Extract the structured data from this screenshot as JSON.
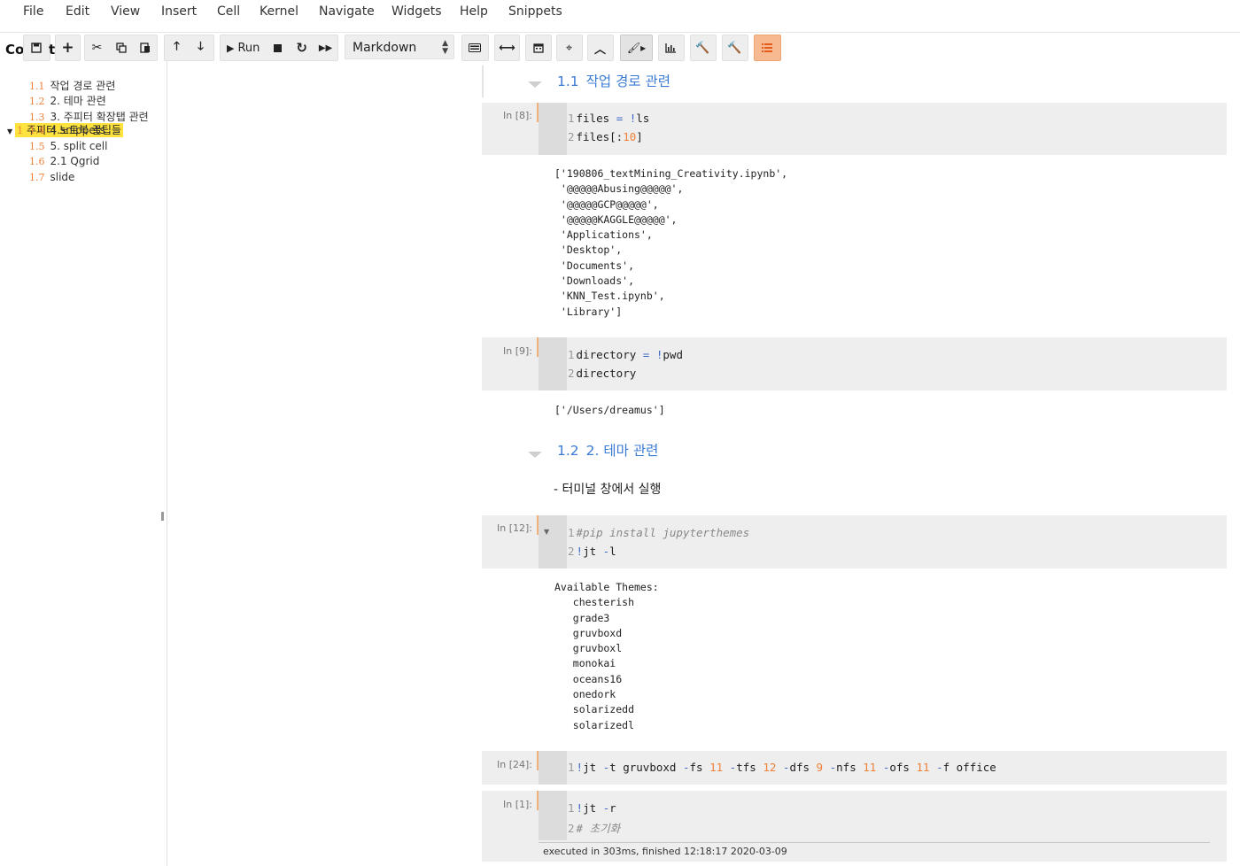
{
  "menu": [
    "File",
    "Edit",
    "View",
    "Insert",
    "Cell",
    "Kernel",
    "Navigate",
    "Widgets",
    "Help",
    "Snippets"
  ],
  "toolbar": {
    "run_label": "Run",
    "cell_type": "Markdown",
    "icons": [
      "save-icon",
      "plus-icon",
      "cut-icon",
      "copy-icon",
      "paste-icon",
      "arrow-up-icon",
      "arrow-down-icon",
      "run-icon",
      "stop-icon",
      "restart-icon",
      "fast-forward-icon",
      "keyboard-icon",
      "horizontal-arrows-icon",
      "calendar-icon",
      "crosshair-icon",
      "chevron-up-icon",
      "brush-icon",
      "bar-chart-icon",
      "hammer-icon",
      "hammer-icon",
      "list-icon"
    ],
    "accent": "#f7b98f"
  },
  "toc": {
    "header_left": "Cor",
    "header_right": "t",
    "top_num": "1",
    "top_label": "주피터 노트북 꿀팁들",
    "items": [
      {
        "num": "1.1",
        "label": "작업 경로 관련"
      },
      {
        "num": "1.2",
        "label": "2. 테마 관련"
      },
      {
        "num": "1.3",
        "label": "3. 주피터 확장탭 관련"
      },
      {
        "num": "1.4",
        "label": "4.snippets"
      },
      {
        "num": "1.5",
        "label": "5. split cell"
      },
      {
        "num": "1.6",
        "label": "2.1 Qgrid"
      },
      {
        "num": "1.7",
        "label": "slide"
      }
    ]
  },
  "notebook": {
    "heading1": {
      "num": "1.1",
      "text": "작업 경로 관련"
    },
    "cell1": {
      "prompt": "In [8]:",
      "lines": [
        {
          "n": "1",
          "parts": [
            {
              "t": "files ",
              "c": ""
            },
            {
              "t": "=",
              "c": "kw"
            },
            {
              "t": " ",
              "c": ""
            },
            {
              "t": "!",
              "c": "kw"
            },
            {
              "t": "ls",
              "c": ""
            }
          ]
        },
        {
          "n": "2",
          "parts": [
            {
              "t": "files[:",
              "c": ""
            },
            {
              "t": "10",
              "c": "num-lit"
            },
            {
              "t": "]",
              "c": ""
            }
          ]
        }
      ],
      "output": "['190806_textMining_Creativity.ipynb',\n '@@@@@Abusing@@@@@',\n '@@@@@GCP@@@@@',\n '@@@@@KAGGLE@@@@@',\n 'Applications',\n 'Desktop',\n 'Documents',\n 'Downloads',\n 'KNN_Test.ipynb',\n 'Library']"
    },
    "cell2": {
      "prompt": "In [9]:",
      "lines": [
        {
          "n": "1",
          "parts": [
            {
              "t": "directory ",
              "c": ""
            },
            {
              "t": "=",
              "c": "kw"
            },
            {
              "t": " ",
              "c": ""
            },
            {
              "t": "!",
              "c": "kw"
            },
            {
              "t": "pwd",
              "c": ""
            }
          ]
        },
        {
          "n": "2",
          "parts": [
            {
              "t": "directory",
              "c": ""
            }
          ]
        }
      ],
      "output": "['/Users/dreamus']"
    },
    "heading2": {
      "num": "1.2",
      "text": "2. 테마 관련"
    },
    "md_text": "- 터미널 창에서 실행",
    "cell3": {
      "prompt": "In [12]:",
      "lines": [
        {
          "n": "1",
          "parts": [
            {
              "t": "#pip install jupyterthemes",
              "c": "cm"
            }
          ]
        },
        {
          "n": "2",
          "parts": [
            {
              "t": "!",
              "c": "kw"
            },
            {
              "t": "jt ",
              "c": ""
            },
            {
              "t": "-",
              "c": "kw"
            },
            {
              "t": "l",
              "c": ""
            }
          ]
        }
      ],
      "output": "Available Themes: \n   chesterish\n   grade3\n   gruvboxd\n   gruvboxl\n   monokai\n   oceans16\n   onedork\n   solarizedd\n   solarizedl"
    },
    "cell4": {
      "prompt": "In [24]:",
      "lines": [
        {
          "n": "1",
          "parts": [
            {
              "t": "!",
              "c": "kw"
            },
            {
              "t": "jt ",
              "c": ""
            },
            {
              "t": "-",
              "c": "kw"
            },
            {
              "t": "t gruvboxd ",
              "c": ""
            },
            {
              "t": "-",
              "c": "kw"
            },
            {
              "t": "fs ",
              "c": ""
            },
            {
              "t": "11",
              "c": "num-lit"
            },
            {
              "t": " ",
              "c": ""
            },
            {
              "t": "-",
              "c": "kw"
            },
            {
              "t": "tfs ",
              "c": ""
            },
            {
              "t": "12",
              "c": "num-lit"
            },
            {
              "t": " ",
              "c": ""
            },
            {
              "t": "-",
              "c": "kw"
            },
            {
              "t": "dfs ",
              "c": ""
            },
            {
              "t": "9",
              "c": "num-lit"
            },
            {
              "t": " ",
              "c": ""
            },
            {
              "t": "-",
              "c": "kw"
            },
            {
              "t": "nfs ",
              "c": ""
            },
            {
              "t": "11",
              "c": "num-lit"
            },
            {
              "t": " ",
              "c": ""
            },
            {
              "t": "-",
              "c": "kw"
            },
            {
              "t": "ofs ",
              "c": ""
            },
            {
              "t": "11",
              "c": "num-lit"
            },
            {
              "t": " ",
              "c": ""
            },
            {
              "t": "-",
              "c": "kw"
            },
            {
              "t": "f office",
              "c": ""
            }
          ]
        }
      ]
    },
    "cell5": {
      "prompt": "In [1]:",
      "lines": [
        {
          "n": "1",
          "parts": [
            {
              "t": "!",
              "c": "kw"
            },
            {
              "t": "jt ",
              "c": ""
            },
            {
              "t": "-",
              "c": "kw"
            },
            {
              "t": "r",
              "c": ""
            }
          ]
        },
        {
          "n": "2",
          "parts": [
            {
              "t": "# 초기화",
              "c": "cm"
            }
          ]
        }
      ],
      "exec_note": "executed in 303ms, finished 12:18:17 2020-03-09"
    }
  }
}
